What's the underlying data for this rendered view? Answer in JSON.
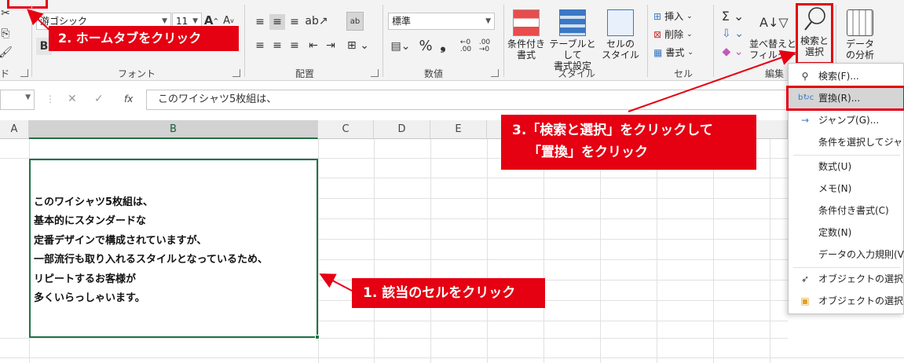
{
  "ribbon": {
    "font_name": "游ゴシック",
    "font_size": "11",
    "number_format": "標準",
    "groups": {
      "clipboard_fragment": "ド",
      "font": "フォント",
      "alignment": "配置",
      "number": "数値",
      "style": "スタイル",
      "cells": "セル",
      "editing": "編集"
    },
    "number_percent": "%",
    "number_comma": "❟",
    "style_buttons": {
      "conditional": [
        "条件付き",
        "書式"
      ],
      "table": [
        "テーブルとして",
        "書式設定"
      ],
      "cell_style": [
        "セルの",
        "スタイル"
      ]
    },
    "cells_buttons": {
      "insert": "挿入",
      "delete": "削除",
      "format": "書式"
    },
    "editing_buttons": {
      "sort": [
        "並べ替えと",
        "フィルター"
      ],
      "find": [
        "検索と",
        "選択"
      ]
    },
    "analyze": [
      "データ",
      "の分析"
    ]
  },
  "formula_bar": {
    "fx": "fx",
    "content": "このワイシャツ5枚組は、"
  },
  "columns": [
    "A",
    "B",
    "C",
    "D",
    "E"
  ],
  "cell_b2": {
    "lines": [
      "このワイシャツ5枚組は、",
      "基本的にスタンダードな",
      "定番デザインで構成されていますが、",
      "一部流行も取り入れるスタイルとなっているため、",
      "リピートするお客様が",
      "多くいらっしゃいます。"
    ]
  },
  "menu": {
    "items": [
      {
        "label": "検索(F)...",
        "icon": "search-icon"
      },
      {
        "label": "置換(R)...",
        "icon": "replace-icon"
      },
      {
        "label": "ジャンプ(G)...",
        "icon": "arrow-right-icon"
      },
      {
        "label": "条件を選択してジャンプ",
        "icon": ""
      },
      {
        "label": "数式(U)",
        "icon": ""
      },
      {
        "label": "メモ(N)",
        "icon": ""
      },
      {
        "label": "条件付き書式(C)",
        "icon": ""
      },
      {
        "label": "定数(N)",
        "icon": ""
      },
      {
        "label": "データの入力規則(V)",
        "icon": ""
      },
      {
        "label": "オブジェクトの選択(O)",
        "icon": "pointer-icon"
      },
      {
        "label": "オブジェクトの選択と表示",
        "icon": "selection-pane-icon"
      }
    ]
  },
  "callouts": {
    "step1": "1. 該当のセルをクリック",
    "step2": "2. ホームタブをクリック",
    "step3_line1": "3.「検索と選択」をクリックして",
    "step3_line2": "「置換」をクリック"
  },
  "colors": {
    "accent_red": "#e50012",
    "excel_green": "#217346"
  }
}
